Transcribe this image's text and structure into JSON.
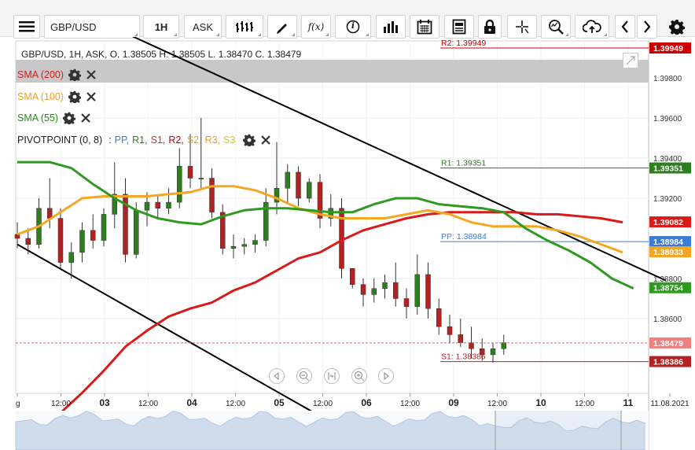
{
  "toolbar": {
    "symbol": "GBP/USD",
    "timeframe": "1H",
    "price_type": "ASK",
    "function_label": "f(x)",
    "info_label": "i"
  },
  "legend": {
    "ohlc": "GBP/USD, 1H, ASK,  O. 1.38505 H. 1.38505 L. 1.38470 C. 1.38479",
    "sma200": "SMA (200)",
    "sma100": "SMA (100)",
    "sma55": "SMA (55)",
    "pivot_name": "PIVOTPOINT (0, 8)",
    "pivot_sep": ":",
    "pivot_items": [
      {
        "label": "PP,",
        "color": "#3a7bd5"
      },
      {
        "label": "R1,",
        "color": "#2e7d1f"
      },
      {
        "label": "S1,",
        "color": "#c0392b"
      },
      {
        "label": "R2,",
        "color": "#cc0000"
      },
      {
        "label": "S2,",
        "color": "#f0a020"
      },
      {
        "label": "R3,",
        "color": "#f0a020"
      },
      {
        "label": "S3",
        "color": "#e8c200"
      }
    ]
  },
  "colors": {
    "sma200": "#d91a1a",
    "sma100": "#f5a623",
    "sma55": "#2e9a1f",
    "up": "#2e7d1f",
    "down": "#b22222",
    "trend": "#000000"
  },
  "chart_data": {
    "type": "candlestick",
    "symbol": "GBP/USD",
    "interval": "1H",
    "price_type": "ASK",
    "ohlc_last": {
      "open": 1.38505,
      "high": 1.38505,
      "low": 1.3847,
      "close": 1.38479
    },
    "y_axis": {
      "ticks": [
        1.398,
        1.396,
        1.394,
        1.392,
        1.388,
        1.386
      ],
      "tick_labels": [
        "1.39800",
        "1.39600",
        "1.39400",
        "1.39200",
        "1.38800",
        "1.38600"
      ],
      "ylim": [
        1.3797,
        1.4008
      ]
    },
    "x_axis": {
      "labels": [
        "g",
        "12:00",
        "03",
        "12:00",
        "04",
        "12:00",
        "05",
        "12:00",
        "06",
        "12:00",
        "09",
        "12:00",
        "10",
        "12:00",
        "11",
        "11.08.2021"
      ],
      "bold": [
        false,
        false,
        true,
        false,
        true,
        false,
        true,
        false,
        true,
        false,
        true,
        false,
        true,
        false,
        true,
        false
      ]
    },
    "levels": [
      {
        "name": "R2",
        "label": "R2: 1.39949",
        "value": 1.39949,
        "tag": "1.39949",
        "color": "#cc0000"
      },
      {
        "name": "R1",
        "label": "R1: 1.39351",
        "value": 1.39351,
        "tag": "1.39351",
        "color": "#2e7d1f"
      },
      {
        "name": "PP",
        "label": "PP: 1.38984",
        "value": 1.38984,
        "tag": "1.38984",
        "color": "#3a7bd5"
      },
      {
        "name": "S1",
        "label": "S1: 1.38386",
        "value": 1.38386,
        "tag": "1.38386",
        "color": "#b22222"
      }
    ],
    "price_tags": [
      {
        "series": "SMA (200)",
        "value": 1.39082,
        "tag": "1.39082",
        "color": "#d91a1a"
      },
      {
        "series": "SMA (100)",
        "value": 1.38933,
        "tag": "1.38933",
        "color": "#f5a623"
      },
      {
        "series": "SMA (55)",
        "value": 1.38754,
        "tag": "1.38754",
        "color": "#2e9a1f"
      },
      {
        "series": "Last",
        "value": 1.38479,
        "tag": "1.38479",
        "color": "#f08080"
      }
    ],
    "trend_lines": [
      {
        "name": "upper",
        "from": [
          0.0,
          1.4027
        ],
        "to": [
          30.0,
          1.3879
        ]
      },
      {
        "name": "lower",
        "from": [
          0.0,
          1.3897
        ],
        "to": [
          16.2,
          1.3798
        ]
      }
    ],
    "sma200": [
      [
        0.0,
        1.3799
      ],
      [
        1.0,
        1.3806
      ],
      [
        2.0,
        1.3813
      ],
      [
        3.0,
        1.3823
      ],
      [
        4.0,
        1.3834
      ],
      [
        5.0,
        1.3846
      ],
      [
        6.0,
        1.3854
      ],
      [
        7.0,
        1.3861
      ],
      [
        8.0,
        1.3865
      ],
      [
        9.0,
        1.3868
      ],
      [
        10.0,
        1.3874
      ],
      [
        11.0,
        1.3878
      ],
      [
        12.0,
        1.3884
      ],
      [
        13.0,
        1.389
      ],
      [
        14.0,
        1.3893
      ],
      [
        15.0,
        1.3899
      ],
      [
        16.0,
        1.3904
      ],
      [
        17.0,
        1.3907
      ],
      [
        18.0,
        1.391
      ],
      [
        19.0,
        1.3912
      ],
      [
        20.0,
        1.3913
      ],
      [
        21.0,
        1.3913
      ],
      [
        22.0,
        1.3913
      ],
      [
        23.0,
        1.3913
      ],
      [
        24.0,
        1.3912
      ],
      [
        25.0,
        1.3912
      ],
      [
        26.0,
        1.3911
      ],
      [
        27.0,
        1.391
      ],
      [
        28.0,
        1.3908
      ]
    ],
    "sma100": [
      [
        0.0,
        1.3902
      ],
      [
        1.0,
        1.3906
      ],
      [
        2.0,
        1.3913
      ],
      [
        3.0,
        1.392
      ],
      [
        4.0,
        1.3921
      ],
      [
        5.0,
        1.3921
      ],
      [
        6.0,
        1.3921
      ],
      [
        7.0,
        1.3922
      ],
      [
        8.0,
        1.3923
      ],
      [
        9.0,
        1.3926
      ],
      [
        10.0,
        1.3926
      ],
      [
        11.0,
        1.3924
      ],
      [
        12.0,
        1.392
      ],
      [
        13.0,
        1.3915
      ],
      [
        14.0,
        1.3912
      ],
      [
        15.0,
        1.391
      ],
      [
        16.0,
        1.391
      ],
      [
        17.0,
        1.391
      ],
      [
        18.0,
        1.3912
      ],
      [
        19.0,
        1.3914
      ],
      [
        20.0,
        1.3912
      ],
      [
        21.0,
        1.3908
      ],
      [
        22.0,
        1.3906
      ],
      [
        23.0,
        1.3906
      ],
      [
        24.0,
        1.3906
      ],
      [
        25.0,
        1.3904
      ],
      [
        26.0,
        1.3901
      ],
      [
        27.0,
        1.3897
      ],
      [
        28.0,
        1.3893
      ]
    ],
    "sma55": [
      [
        0.0,
        1.3938
      ],
      [
        1.5,
        1.3938
      ],
      [
        2.5,
        1.3935
      ],
      [
        3.5,
        1.3927
      ],
      [
        4.5,
        1.392
      ],
      [
        5.5,
        1.3914
      ],
      [
        6.5,
        1.391
      ],
      [
        7.5,
        1.3908
      ],
      [
        8.5,
        1.3907
      ],
      [
        9.5,
        1.3911
      ],
      [
        10.5,
        1.3914
      ],
      [
        11.5,
        1.3915
      ],
      [
        12.5,
        1.3915
      ],
      [
        13.5,
        1.3914
      ],
      [
        14.5,
        1.3913
      ],
      [
        15.5,
        1.3913
      ],
      [
        16.5,
        1.3917
      ],
      [
        17.5,
        1.392
      ],
      [
        18.5,
        1.392
      ],
      [
        19.5,
        1.3917
      ],
      [
        20.5,
        1.3916
      ],
      [
        21.5,
        1.3915
      ],
      [
        22.5,
        1.3913
      ],
      [
        23.5,
        1.3905
      ],
      [
        24.5,
        1.3899
      ],
      [
        25.5,
        1.3894
      ],
      [
        26.5,
        1.3888
      ],
      [
        27.5,
        1.388
      ],
      [
        28.5,
        1.3875
      ]
    ],
    "candles": [
      [
        0.0,
        1.3902,
        1.3908,
        1.3895,
        1.39
      ],
      [
        0.5,
        1.39,
        1.3905,
        1.3892,
        1.3897
      ],
      [
        1.0,
        1.3897,
        1.392,
        1.3895,
        1.3915
      ],
      [
        1.5,
        1.3915,
        1.393,
        1.3905,
        1.391
      ],
      [
        2.0,
        1.391,
        1.3915,
        1.3885,
        1.3888
      ],
      [
        2.5,
        1.3888,
        1.3898,
        1.388,
        1.3893
      ],
      [
        3.0,
        1.3893,
        1.3908,
        1.3888,
        1.3904
      ],
      [
        3.5,
        1.3904,
        1.3912,
        1.3895,
        1.3899
      ],
      [
        4.0,
        1.3899,
        1.3915,
        1.3896,
        1.3912
      ],
      [
        4.5,
        1.3912,
        1.3938,
        1.3905,
        1.3922
      ],
      [
        5.0,
        1.3922,
        1.393,
        1.3888,
        1.3892
      ],
      [
        5.5,
        1.3892,
        1.3918,
        1.389,
        1.3914
      ],
      [
        6.0,
        1.3914,
        1.3923,
        1.3906,
        1.3918
      ],
      [
        6.5,
        1.3918,
        1.3922,
        1.391,
        1.3915
      ],
      [
        7.0,
        1.3915,
        1.3925,
        1.3912,
        1.3918
      ],
      [
        7.5,
        1.3918,
        1.3945,
        1.3915,
        1.3936
      ],
      [
        8.0,
        1.3936,
        1.3952,
        1.3925,
        1.393
      ],
      [
        8.5,
        1.393,
        1.396,
        1.3925,
        1.393
      ],
      [
        9.0,
        1.393,
        1.3935,
        1.391,
        1.3913
      ],
      [
        9.5,
        1.3913,
        1.3917,
        1.3892,
        1.3895
      ],
      [
        10.0,
        1.3895,
        1.3902,
        1.389,
        1.3896
      ],
      [
        10.5,
        1.3896,
        1.39,
        1.3892,
        1.3897
      ],
      [
        11.0,
        1.3897,
        1.3902,
        1.3893,
        1.3899
      ],
      [
        11.5,
        1.3899,
        1.3925,
        1.3896,
        1.3918
      ],
      [
        12.0,
        1.3918,
        1.3948,
        1.3912,
        1.3925
      ],
      [
        12.5,
        1.3925,
        1.3937,
        1.3918,
        1.3933
      ],
      [
        13.0,
        1.3933,
        1.3936,
        1.3916,
        1.392
      ],
      [
        13.5,
        1.392,
        1.393,
        1.3918,
        1.3928
      ],
      [
        14.0,
        1.3928,
        1.3932,
        1.3905,
        1.391
      ],
      [
        14.5,
        1.391,
        1.3922,
        1.3906,
        1.3915
      ],
      [
        15.0,
        1.3915,
        1.392,
        1.388,
        1.3885
      ],
      [
        15.5,
        1.3885,
        1.3882,
        1.3875,
        1.3877
      ],
      [
        16.0,
        1.3877,
        1.388,
        1.3866,
        1.3872
      ],
      [
        16.5,
        1.3872,
        1.388,
        1.3868,
        1.3875
      ],
      [
        17.0,
        1.3875,
        1.3882,
        1.387,
        1.3878
      ],
      [
        17.5,
        1.3878,
        1.3888,
        1.3866,
        1.387
      ],
      [
        18.0,
        1.387,
        1.3875,
        1.386,
        1.3866
      ],
      [
        18.5,
        1.3866,
        1.3892,
        1.3862,
        1.3882
      ],
      [
        19.0,
        1.3882,
        1.3888,
        1.386,
        1.3865
      ],
      [
        19.5,
        1.3865,
        1.387,
        1.3852,
        1.3856
      ],
      [
        20.0,
        1.3856,
        1.3862,
        1.3848,
        1.3852
      ],
      [
        20.5,
        1.3852,
        1.386,
        1.3846,
        1.3848
      ],
      [
        21.0,
        1.3848,
        1.3856,
        1.384,
        1.3845
      ],
      [
        21.5,
        1.3845,
        1.385,
        1.3839,
        1.3842
      ],
      [
        22.0,
        1.3842,
        1.3848,
        1.3838,
        1.3845
      ],
      [
        22.5,
        1.3845,
        1.3852,
        1.3842,
        1.3848
      ]
    ]
  },
  "nav_buttons": [
    "scroll-left",
    "zoom-out",
    "reset-zoom",
    "zoom-in",
    "scroll-right"
  ]
}
